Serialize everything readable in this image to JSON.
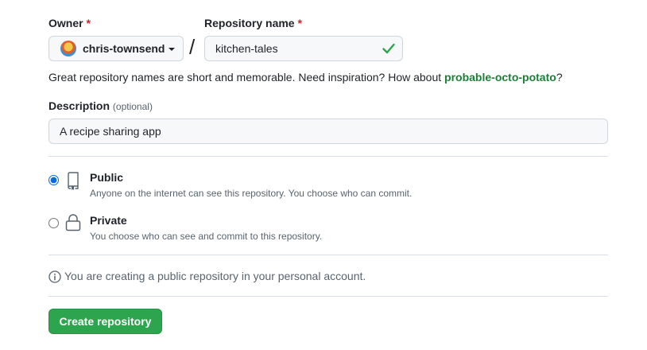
{
  "owner": {
    "label": "Owner",
    "required_mark": "*",
    "value": "chris-townsend",
    "avatar_icon": "user-avatar"
  },
  "repository_name": {
    "label": "Repository name",
    "required_mark": "*",
    "value": "kitchen-tales",
    "valid_icon": "check-icon",
    "valid_color": "#2da44e"
  },
  "separator": "/",
  "name_hint": {
    "text": "Great repository names are short and memorable. Need inspiration? How about ",
    "suggestion": "probable-octo-potato",
    "suffix": "?"
  },
  "description": {
    "label": "Description",
    "optional_text": "(optional)",
    "value": "A recipe sharing app"
  },
  "visibility": {
    "selected": "public",
    "options": [
      {
        "id": "public",
        "title": "Public",
        "description": "Anyone on the internet can see this repository. You choose who can commit.",
        "icon": "repo-icon"
      },
      {
        "id": "private",
        "title": "Private",
        "description": "You choose who can see and commit to this repository.",
        "icon": "lock-icon"
      }
    ]
  },
  "info_note": {
    "icon": "info-icon",
    "text": "You are creating a public repository in your personal account."
  },
  "submit": {
    "label": "Create repository",
    "color": "#2da44e"
  }
}
